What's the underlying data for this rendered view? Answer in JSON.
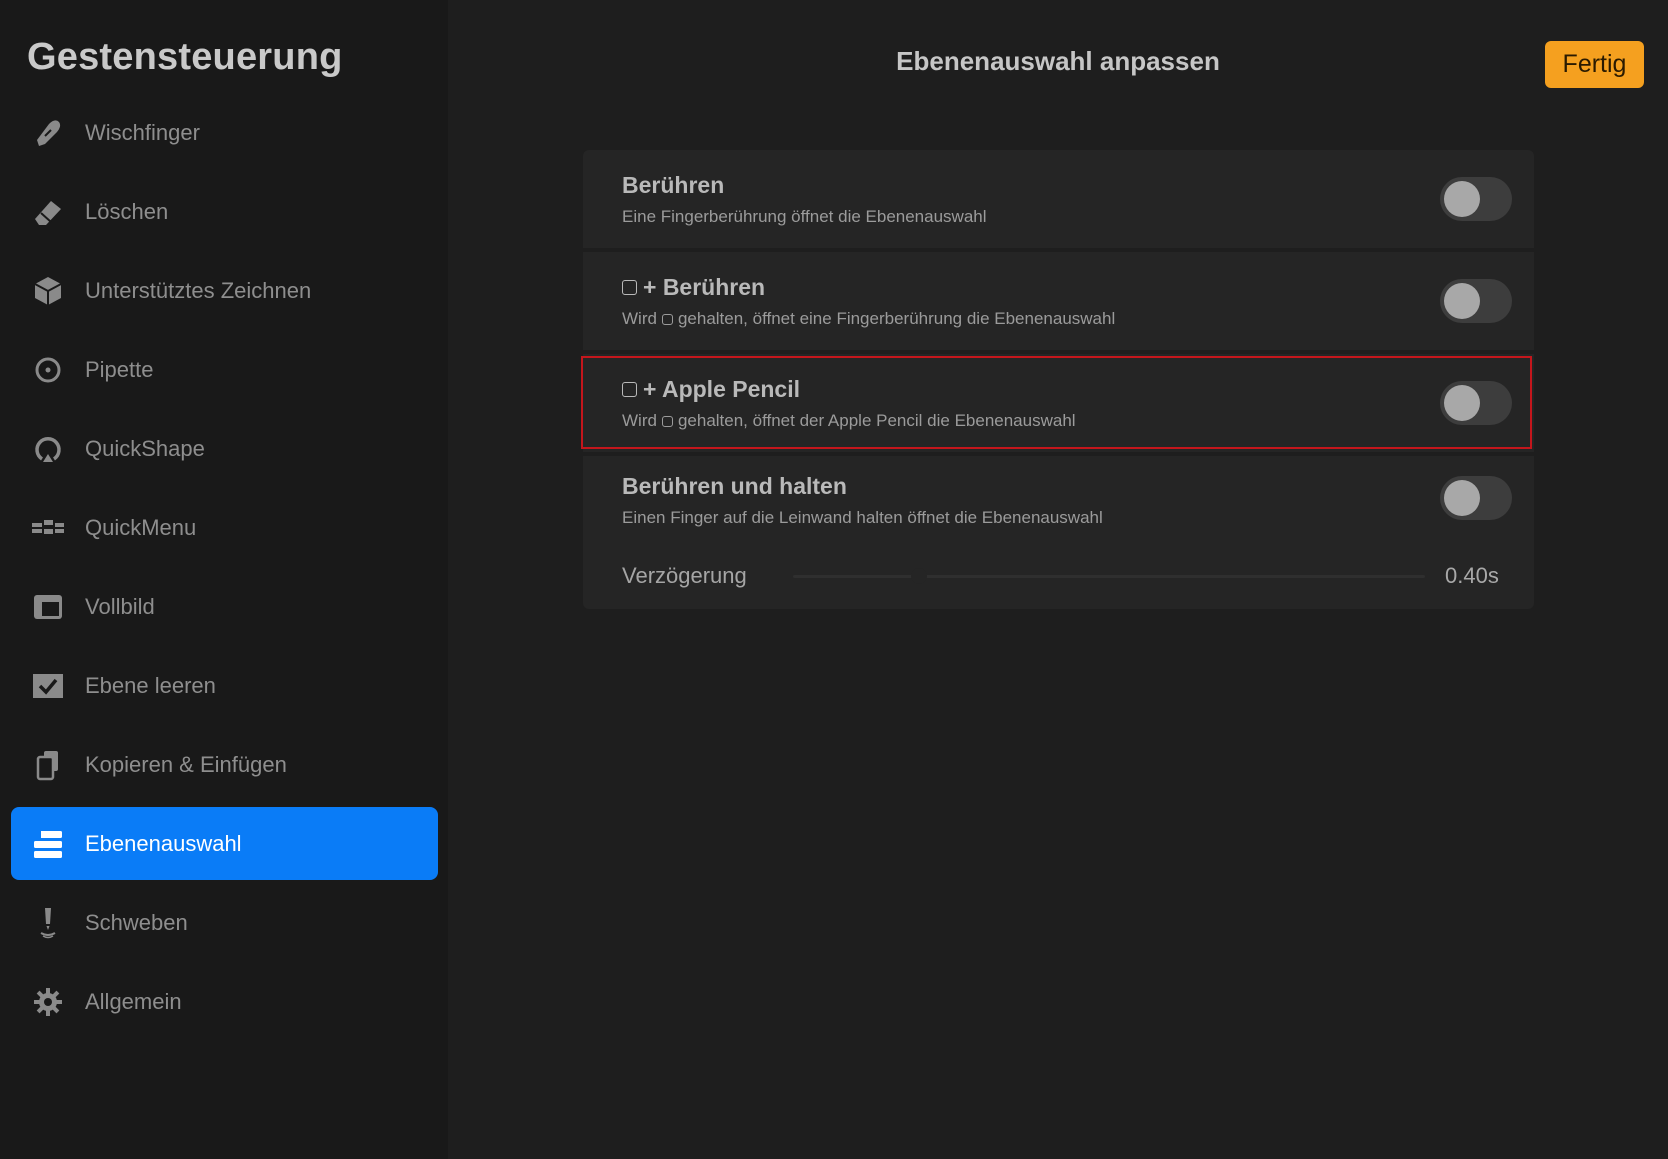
{
  "sidebar": {
    "title": "Gestensteuerung",
    "items": [
      {
        "label": "Wischfinger",
        "icon": "smudge-finger-icon"
      },
      {
        "label": "Löschen",
        "icon": "eraser-icon"
      },
      {
        "label": "Unterstütztes Zeichnen",
        "icon": "cube-icon"
      },
      {
        "label": "Pipette",
        "icon": "eyedropper-icon"
      },
      {
        "label": "QuickShape",
        "icon": "quickshape-icon"
      },
      {
        "label": "QuickMenu",
        "icon": "quickmenu-icon"
      },
      {
        "label": "Vollbild",
        "icon": "fullscreen-icon"
      },
      {
        "label": "Ebene leeren",
        "icon": "clear-layer-icon"
      },
      {
        "label": "Kopieren & Einfügen",
        "icon": "copy-paste-icon"
      },
      {
        "label": "Ebenenauswahl",
        "icon": "layer-select-icon",
        "active": true
      },
      {
        "label": "Schweben",
        "icon": "hover-icon"
      },
      {
        "label": "Allgemein",
        "icon": "gear-icon"
      }
    ]
  },
  "header": {
    "title": "Ebenenauswahl anpassen",
    "done_label": "Fertig"
  },
  "settings": [
    {
      "title": "Berühren",
      "subtitle": "Eine Fingerberührung öffnet die Ebenenauswahl",
      "enabled": false
    },
    {
      "title": "+ Berühren",
      "subtitle_pre": "Wird",
      "subtitle_post": "gehalten, öffnet eine Fingerberührung die Ebenenauswahl",
      "enabled": false
    },
    {
      "title": "+ Apple Pencil",
      "subtitle_pre": "Wird",
      "subtitle_post": "gehalten, öffnet der Apple Pencil die Ebenenauswahl",
      "enabled": false
    },
    {
      "title": "Berühren und halten",
      "subtitle": "Einen Finger auf die Leinwand halten öffnet die Ebenenauswahl",
      "enabled": false
    }
  ],
  "delay": {
    "label": "Verzögerung",
    "value": "0.40s",
    "fraction": 0.2
  },
  "colors": {
    "accent": "#0a7cf7",
    "done_button": "#f5a01f",
    "highlight": "#c4161c"
  }
}
